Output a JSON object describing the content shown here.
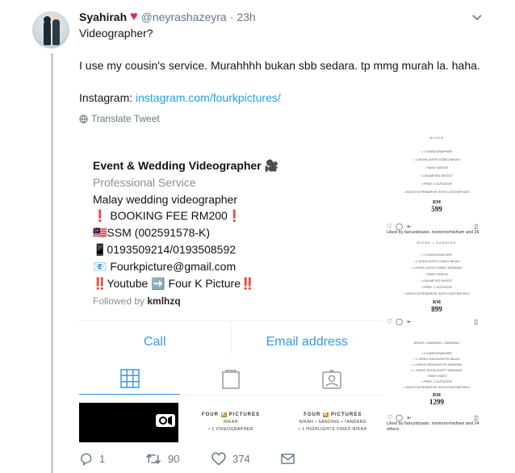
{
  "tweet": {
    "display_name": "Syahirah",
    "handle": "@neyrashazeyra",
    "separator": "·",
    "time": "23h",
    "question": "Videographer?",
    "body": "I use my cousin's service. Murahhhh bukan sbb sedara. tp mmg murah la. haha.",
    "instagram_label": "Instagram: ",
    "instagram_link": "instagram.com/fourkpictures/",
    "translate": "Translate Tweet"
  },
  "profile": {
    "title": "Event & Wedding Videographer 🎥",
    "category": "Professional Service",
    "line1": "Malay wedding videographer",
    "line2": "❗ BOOKING FEE RM200❗",
    "line3": "🇲🇾SSM (002591578-K)",
    "line4": "📱0193509214/0193508592",
    "line5": "📧 Fourkpicture@gmail.com",
    "line6": "‼️Youtube ➡️ Four K Picture‼️",
    "followed_prefix": "Followed by ",
    "followed_user": "kmlhzq",
    "call": "Call",
    "email": "Email address"
  },
  "thumbs": {
    "brand_a": "FOUR",
    "brand_k": "K",
    "brand_b": "PICTURES",
    "t2_sub": "NIKAH",
    "t2_line": "• 1 VIDEOGRAPHER",
    "t3_sub": "NIKAH • SANDING • TANDANG",
    "t3_line": "• 1 HIGHLIGHTS VIDEO NIKAH"
  },
  "side": {
    "p1_head": "NIKAH",
    "p1_items": [
      "• 1 VIDEOGRAPHER",
      "• 1 HIGHLIGHTS VIDEO NIKAH",
      "• RAW VIDEOS",
      "• UNLIMITED SHOOT",
      "• FREE 1 OUTDOOR",
      "• VIDEO IN PENDRIVE WITH LEATHER BOX"
    ],
    "p1_price": "599",
    "p1_likes": "Liked by fairuzidzwan, norisnnorhisham and 36",
    "p2_head": "NIKAH • SANDING",
    "p2_items": [
      "• 1 VIDEOGRAPHER",
      "• 1 HIGHLIGHTS VIDEO NIKAH",
      "• 1 HIGHLIGHTS VIDEO SANDING",
      "• RAW VIDEOS",
      "• UNLIMITED SHOOT",
      "• FREE 1 OUTDOOR",
      "• VIDEO IN PENDRIVE WITH LEATHER BOX"
    ],
    "p2_price": "899",
    "p3_head": "NIKAH • SANDING • TANDANG",
    "p3_items": [
      "• 2 VIDEOGRAPHER",
      "• 1 VIDEO HIGHLIGHTS NIKAH",
      "• 1 VIDEO HIGHLIGHTS SANDING",
      "• 1 VIDEO HIGHLIGHTS TANDANG",
      "• RAW VIDEO",
      "• FREE 1 OUTDOOR",
      "• VIDEO IN PENDRIVE WITH LEATHER BOX"
    ],
    "p3_price": "1299",
    "p3_likes": "Liked by fairuzidzwan, norisnnorhisham and 24",
    "p3_likes2": "others",
    "rm": "RM"
  },
  "actions": {
    "reply_count": "1",
    "retweet_count": "90",
    "like_count": "374"
  },
  "colors": {
    "link": "#1da1f2",
    "heart": "#e0245e",
    "ig_blue": "#3897f0"
  }
}
